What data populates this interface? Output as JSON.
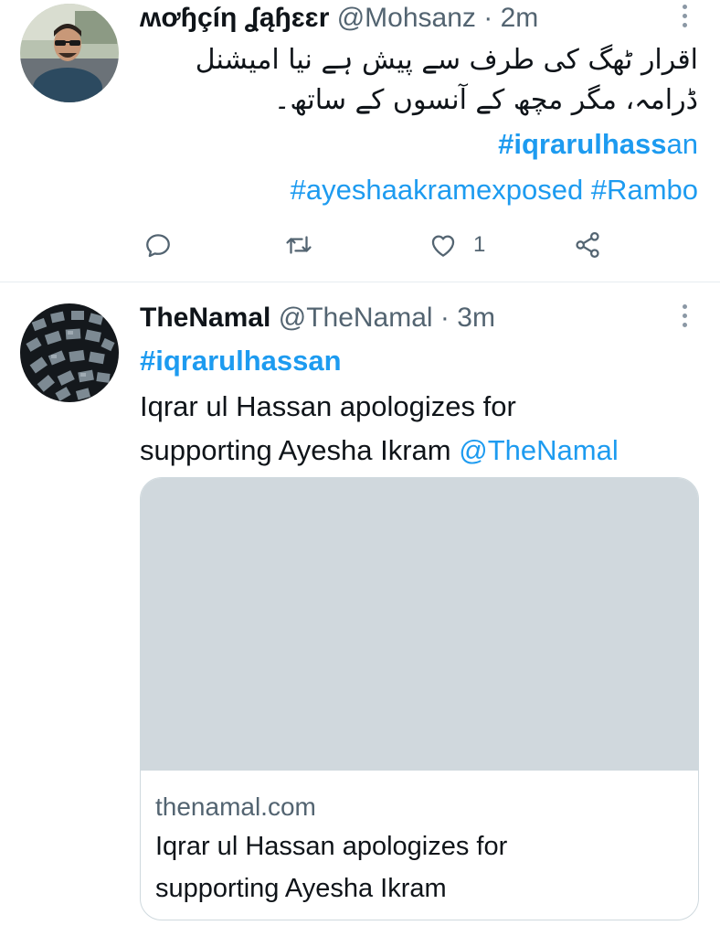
{
  "tweets": [
    {
      "display_name": "ʍơɧçíη ʆąɧɛɛr",
      "handle": "@Mohsanz",
      "separator": "·",
      "time": "2m",
      "urdu_lines": [
        "اقرار ٹھگ کی طرف سے پیش ہے نیا امیشنل",
        "ڈرامہ، مگر مچھ کے آنسوں کے ساتھ۔"
      ],
      "hashtags_line1_bold": "#iqrarulhass",
      "hashtags_line1_rest": "an",
      "hashtags_line2": "#ayeshaakramexposed #Rambo",
      "like_count": "1",
      "icons": {
        "reply": "reply-icon",
        "retweet": "retweet-icon",
        "like": "heart-icon",
        "share": "share-icon",
        "more": "more-vertical-icon"
      }
    },
    {
      "display_name": "TheNamal",
      "handle": "@TheNamal",
      "separator": "·",
      "time": "3m",
      "hashtag": "#iqrarulhassan",
      "text_line1": "Iqrar ul Hassan apologizes for",
      "text_line2": "supporting Ayesha Ikram",
      "mention": "@TheNamal",
      "card": {
        "domain": "thenamal.com",
        "title_line1": "Iqrar ul Hassan apologizes for",
        "title_line2": "supporting Ayesha Ikram"
      }
    }
  ],
  "colors": {
    "link": "#1d9bf0",
    "secondary_text": "#536471",
    "divider": "#e6ecf0",
    "card_placeholder": "#d0d8dd"
  }
}
